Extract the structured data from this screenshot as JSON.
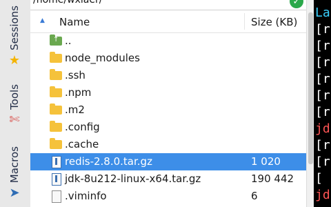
{
  "path_bar": {
    "value": "/home/wxiaer/"
  },
  "side_tabs": [
    {
      "label": "Sessions",
      "icon": "star-icon",
      "glyph": "★"
    },
    {
      "label": "Tools",
      "icon": "tools-icon",
      "glyph": "✄"
    },
    {
      "label": "Macros",
      "icon": "send-icon",
      "glyph": "➤"
    }
  ],
  "columns": {
    "name": "Name",
    "size": "Size (KB)"
  },
  "files": [
    {
      "name": "..",
      "size": "",
      "type": "up",
      "selected": false
    },
    {
      "name": "node_modules",
      "size": "",
      "type": "folder",
      "selected": false
    },
    {
      "name": ".ssh",
      "size": "",
      "type": "folder",
      "selected": false
    },
    {
      "name": ".npm",
      "size": "",
      "type": "folder",
      "selected": false
    },
    {
      "name": ".m2",
      "size": "",
      "type": "folder",
      "selected": false
    },
    {
      "name": ".config",
      "size": "",
      "type": "folder",
      "selected": false
    },
    {
      "name": ".cache",
      "size": "",
      "type": "folder",
      "selected": false
    },
    {
      "name": "redis-2.8.0.tar.gz",
      "size": "1 020",
      "type": "archive",
      "selected": true
    },
    {
      "name": "jdk-8u212-linux-x64.tar.gz",
      "size": "190 442",
      "type": "archive",
      "selected": false
    },
    {
      "name": ".viminfo",
      "size": "6",
      "type": "file",
      "selected": false
    }
  ],
  "terminal": {
    "lines": [
      {
        "text": "La",
        "color": "#3ad0ff"
      },
      {
        "text": "[r",
        "color": "#ffffff"
      },
      {
        "text": "[r",
        "color": "#ffffff"
      },
      {
        "text": "[r",
        "color": "#ffffff"
      },
      {
        "text": "[r",
        "color": "#ffffff"
      },
      {
        "text": "[r",
        "color": "#ffffff"
      },
      {
        "text": "[r",
        "color": "#ffffff"
      },
      {
        "text": "jd",
        "color": "#ff5555"
      },
      {
        "text": "[r",
        "color": "#ffffff"
      },
      {
        "text": "[r",
        "color": "#ffffff"
      },
      {
        "text": "[",
        "color": "#ffffff"
      },
      {
        "text": "jd",
        "color": "#ff5555"
      }
    ]
  },
  "colors": {
    "selection": "#3d8ee8",
    "folder": "#f5c23b",
    "terminal_bg": "#000000"
  }
}
